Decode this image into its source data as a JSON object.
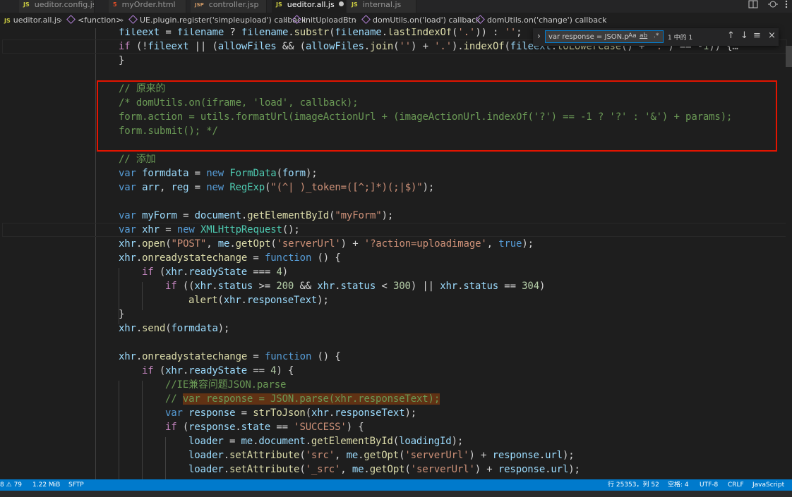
{
  "tabs": [
    {
      "icon": "JS",
      "label": "ueditor.config.js",
      "active": false,
      "modified": false
    },
    {
      "icon": "5",
      "label": "myOrder.html",
      "active": false,
      "modified": false
    },
    {
      "icon": "JSP",
      "label": "controller.jsp",
      "active": false,
      "modified": false
    },
    {
      "icon": "JS",
      "label": "ueditor.all.js",
      "active": true,
      "modified": true
    },
    {
      "icon": "JS",
      "label": "internal.js",
      "active": false,
      "modified": false
    }
  ],
  "breadcrumb": [
    {
      "label": "ueditor.all.js",
      "icon": "js-file-icon"
    },
    {
      "label": "<function>",
      "icon": "function-cube-icon"
    },
    {
      "label": "UE.plugin.register('simpleupload') callback",
      "icon": "function-cube-icon"
    },
    {
      "label": "initUploadBtn",
      "icon": "function-cube-icon"
    },
    {
      "label": "domUtils.on('load') callback",
      "icon": "function-cube-icon"
    },
    {
      "label": "domUtils.on('change') callback",
      "icon": "function-cube-icon"
    }
  ],
  "find": {
    "query": "var response = JSON.p",
    "case_label": "Aa",
    "word_label": "ab",
    "regex_label": ".*",
    "count": "1 中的 1"
  },
  "code_lines": [
    "        fileext = filename ? filename.substr(filename.lastIndexOf('.')) : '';",
    "    if (!fileext || (allowFiles && (allowFiles.join('') + '.').indexOf(fileext.toLowerCase() + '.') == -1)) {…",
    "    }",
    "",
    "    // 原来的",
    "    /* domUtils.on(iframe, 'load', callback);",
    "    form.action = utils.formatUrl(imageActionUrl + (imageActionUrl.indexOf('?') == -1 ? '?' : '&') + params);",
    "    form.submit(); */",
    "",
    "    // 添加",
    "    var formdata = new FormData(form);",
    "    var arr, reg = new RegExp(\"(^| )_token=([^;]*)(;|$)\");",
    "",
    "    var myForm = document.getElementById(\"myForm\");",
    "    var xhr = new XMLHttpRequest();",
    "    xhr.open(\"POST\", me.getOpt('serverUrl') + '?action=uploadimage', true);",
    "    xhr.onreadystatechange = function () {",
    "        if (xhr.readyState === 4)",
    "            if ((xhr.status >= 200 && xhr.status < 300) || xhr.status == 304)",
    "                alert(xhr.responseText);",
    "    }",
    "    xhr.send(formdata);",
    "",
    "    xhr.onreadystatechange = function () {",
    "        if (xhr.readyState == 4) {",
    "            //IE兼容问题JSON.parse",
    "            // var response = JSON.parse(xhr.responseText);",
    "            var response = strToJson(xhr.responseText);",
    "            if (response.state == 'SUCCESS') {",
    "                loader = me.document.getElementById(loadingId);",
    "                loader.setAttribute('src', me.getOpt('serverUrl') + response.url);",
    "                loader.setAttribute('_src', me.getOpt('serverUrl') + response.url);"
  ],
  "status": {
    "problems": "8",
    "warnings": "79",
    "filesize": "1.22 MiB",
    "sftp": "SFTP",
    "position": "行 25353，列 52",
    "spaces": "空格: 4",
    "encoding": "UTF-8",
    "eol": "CRLF",
    "language": "JavaScript"
  },
  "colors": {
    "editor_bg": "#1e1e1e",
    "statusbar_bg": "#007acc",
    "annotation_box": "#e51400",
    "find_highlight": "#613214"
  }
}
